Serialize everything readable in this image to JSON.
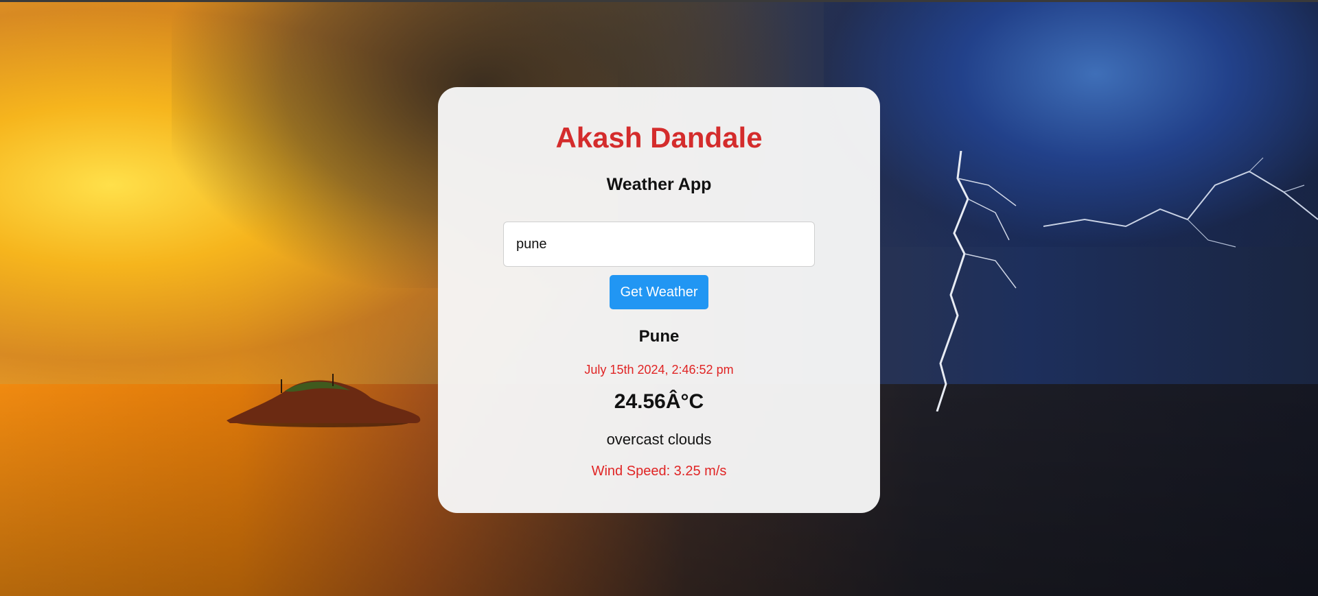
{
  "background": {
    "accent_warm": "#f6b51d",
    "accent_cool": "#22418a"
  },
  "card": {
    "title": "Akash Dandale",
    "subtitle": "Weather App",
    "search": {
      "value": "pune",
      "button_label": "Get Weather"
    },
    "result": {
      "city": "Pune",
      "datetime": "July 15th 2024, 2:46:52 pm",
      "temperature": "24.56Â°C",
      "description": "overcast clouds",
      "wind": "Wind Speed: 3.25 m/s"
    }
  },
  "colors": {
    "title": "#d42c2c",
    "button": "#2196f3",
    "highlight_text": "#e02424"
  }
}
